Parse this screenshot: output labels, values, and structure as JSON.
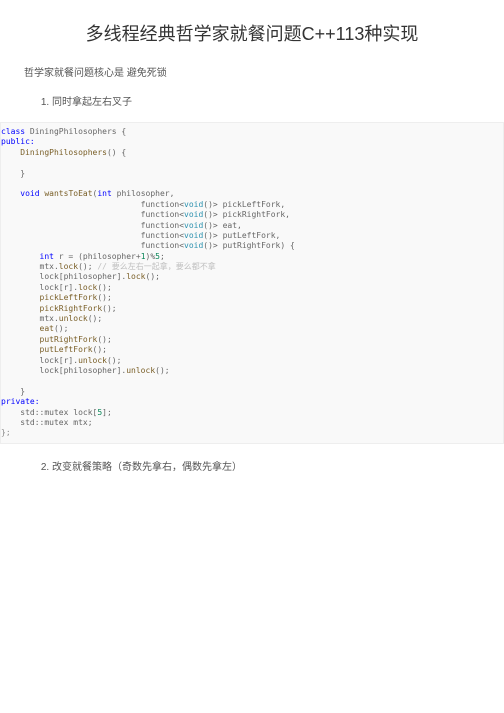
{
  "title": "多线程经典哲学家就餐问题C++113种实现",
  "subtitle": "哲学家就餐问题核心是 避免死锁",
  "items": [
    "同时拿起左右叉子",
    "改变就餐策略（奇数先拿右，偶数先拿左）"
  ],
  "code": {
    "l1a": "class",
    "l1b": " DiningPhilosophers {",
    "l2": "public:",
    "l3a": "    ",
    "l3b": "DiningPhilosophers",
    "l3c": "() {",
    "l4": " ",
    "l5": "    }",
    "l6": " ",
    "l7a": "    ",
    "l7b": "void",
    "l7c": " ",
    "l7d": "wantsToEat",
    "l7e": "(",
    "l7f": "int",
    "l7g": " philosopher,",
    "l8a": "                             function<",
    "l8b": "void",
    "l8c": "()> pickLeftFork,",
    "l9a": "                             function<",
    "l9b": "void",
    "l9c": "()> pickRightFork,",
    "l10a": "                             function<",
    "l10b": "void",
    "l10c": "()> eat,",
    "l11a": "                             function<",
    "l11b": "void",
    "l11c": "()> putLeftFork,",
    "l12a": "                             function<",
    "l12b": "void",
    "l12c": "()> putRightFork) {",
    "l13a": "        ",
    "l13b": "int",
    "l13c": " r = (philosopher+",
    "l13d": "1",
    "l13e": ")%",
    "l13f": "5",
    "l13g": ";",
    "l14a": "        mtx.",
    "l14b": "lock",
    "l14c": "(); ",
    "l14d": "// 要么左右一起拿，要么都不拿",
    "l15a": "        lock[philosopher].",
    "l15b": "lock",
    "l15c": "();",
    "l16a": "        lock[r].",
    "l16b": "lock",
    "l16c": "();",
    "l17a": "        ",
    "l17b": "pickLeftFork",
    "l17c": "();",
    "l18a": "        ",
    "l18b": "pickRightFork",
    "l18c": "();",
    "l19a": "        mtx.",
    "l19b": "unlock",
    "l19c": "();",
    "l20a": "        ",
    "l20b": "eat",
    "l20c": "();",
    "l21a": "        ",
    "l21b": "putRightFork",
    "l21c": "();",
    "l22a": "        ",
    "l22b": "putLeftFork",
    "l22c": "();",
    "l23a": "        lock[r].",
    "l23b": "unlock",
    "l23c": "();",
    "l24a": "        lock[philosopher].",
    "l24b": "unlock",
    "l24c": "();",
    "l25": " ",
    "l26": "    }",
    "l27": "private:",
    "l28a": "    std::mutex lock[",
    "l28b": "5",
    "l28c": "];",
    "l29": "    std::mutex mtx;",
    "l30": "};"
  }
}
